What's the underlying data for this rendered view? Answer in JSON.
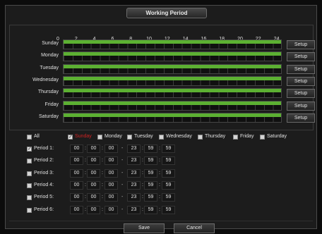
{
  "dialog": {
    "title": "Working Period"
  },
  "hours": [
    "0",
    "2",
    "4",
    "6",
    "8",
    "10",
    "12",
    "14",
    "16",
    "18",
    "20",
    "22",
    "24"
  ],
  "days": [
    {
      "label": "Sunday",
      "setup": "Setup"
    },
    {
      "label": "Monday",
      "setup": "Setup"
    },
    {
      "label": "Tuesday",
      "setup": "Setup"
    },
    {
      "label": "Wednesday",
      "setup": "Setup"
    },
    {
      "label": "Thursday",
      "setup": "Setup"
    },
    {
      "label": "Friday",
      "setup": "Setup"
    },
    {
      "label": "Saturday",
      "setup": "Setup"
    }
  ],
  "day_selector": {
    "all": {
      "label": "All",
      "checked": false
    },
    "items": [
      {
        "label": "Sunday",
        "checked": true
      },
      {
        "label": "Monday",
        "checked": false
      },
      {
        "label": "Tuesday",
        "checked": false
      },
      {
        "label": "Wednesday",
        "checked": false
      },
      {
        "label": "Thursday",
        "checked": false
      },
      {
        "label": "Friday",
        "checked": false
      },
      {
        "label": "Saturday",
        "checked": false
      }
    ]
  },
  "periods": [
    {
      "label": "Period 1:",
      "checked": true,
      "start": [
        "00",
        "00",
        "00"
      ],
      "end": [
        "23",
        "59",
        "59"
      ]
    },
    {
      "label": "Period 2:",
      "checked": false,
      "start": [
        "00",
        "00",
        "00"
      ],
      "end": [
        "23",
        "59",
        "59"
      ]
    },
    {
      "label": "Period 3:",
      "checked": false,
      "start": [
        "00",
        "00",
        "00"
      ],
      "end": [
        "23",
        "59",
        "59"
      ]
    },
    {
      "label": "Period 4:",
      "checked": false,
      "start": [
        "00",
        "00",
        "00"
      ],
      "end": [
        "23",
        "59",
        "59"
      ]
    },
    {
      "label": "Period 5:",
      "checked": false,
      "start": [
        "00",
        "00",
        "00"
      ],
      "end": [
        "23",
        "59",
        "59"
      ]
    },
    {
      "label": "Period 6:",
      "checked": false,
      "start": [
        "00",
        "00",
        "00"
      ],
      "end": [
        "23",
        "59",
        "59"
      ]
    }
  ],
  "time_separator": ":",
  "range_separator": "-",
  "footer": {
    "save_label": "Save",
    "cancel_label": "Cancel"
  },
  "colors": {
    "bar": "#5cb032",
    "selected_day": "#d02222",
    "background": "#1c1c1c"
  }
}
